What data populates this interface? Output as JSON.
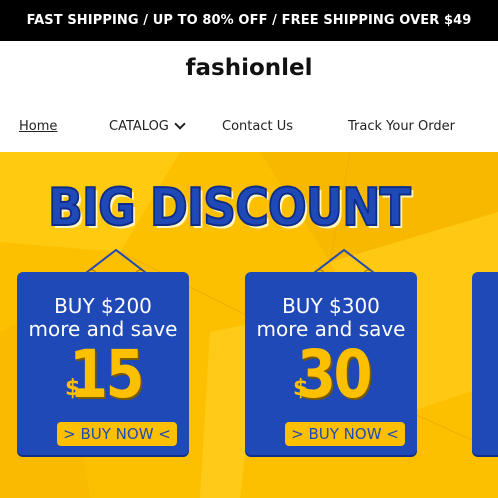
{
  "announcement": "FAST SHIPPING / UP TO 80% OFF / FREE SHIPPING OVER $49",
  "logo": "fashionlel",
  "nav": {
    "home": "Home",
    "catalog": "CATALOG",
    "contact": "Contact Us",
    "track": "Track Your Order"
  },
  "banner": {
    "headline": "BIG DISCOUNT",
    "cards": [
      {
        "line1": "BUY $200",
        "line2": "more and save",
        "currency": "$",
        "amount": "15",
        "button": "> BUY NOW <"
      },
      {
        "line1": "BUY $300",
        "line2": "more and save",
        "currency": "$",
        "amount": "30",
        "button": "> BUY NOW <"
      }
    ]
  },
  "colors": {
    "accent_yellow": "#fcc000",
    "accent_blue": "#1f49b6",
    "topbar": "#000000"
  }
}
